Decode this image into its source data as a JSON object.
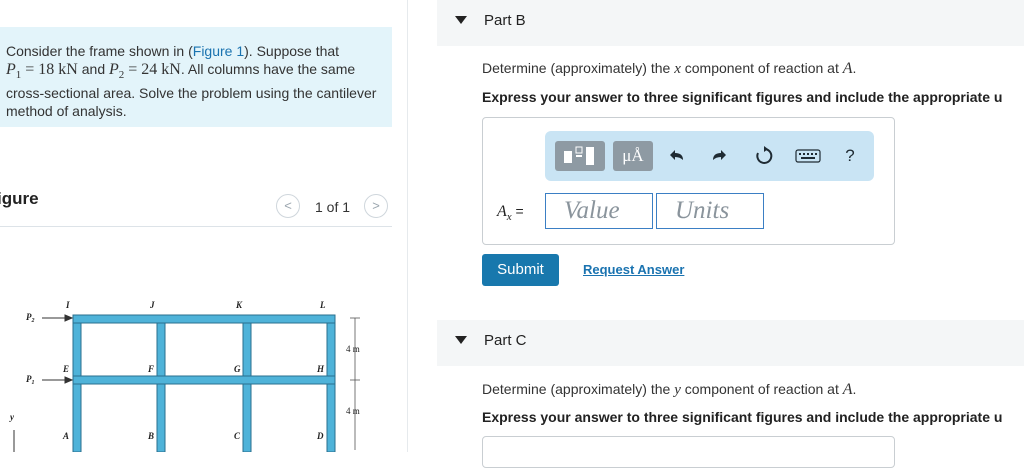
{
  "problem": {
    "intro": "Consider the frame shown in (",
    "figure_link": "Figure 1",
    "after_link": "). Suppose that",
    "p1": "P",
    "p1_sub": "1",
    "p1_val": " = 18 kN",
    "and": " and ",
    "p2": "P",
    "p2_sub": "2",
    "p2_val": " = 24 kN",
    "rest": ". All columns have the same cross-sectional area. Solve the problem using the cantilever method of analysis."
  },
  "figure": {
    "label": "igure",
    "page_indicator": "1 of 1",
    "prev": "<",
    "next": ">",
    "labels": {
      "P2": "P",
      "P2_sub": "2",
      "P1": "P",
      "P1_sub": "1",
      "I": "I",
      "J": "J",
      "K": "K",
      "L": "L",
      "E": "E",
      "F": "F",
      "G": "G",
      "H": "H",
      "A": "A",
      "B": "B",
      "C": "C",
      "D": "D",
      "dim1": "4 m",
      "dim2": "4 m",
      "y": "y"
    }
  },
  "part_b": {
    "title": "Part B",
    "question_prefix": "Determine (approximately) the ",
    "question_var": "x",
    "question_mid": " component of reaction at ",
    "question_point": "A",
    "question_end": ".",
    "instruction": "Express your answer to three significant figures and include the appropriate u",
    "answer_label": "A",
    "answer_sub": "x",
    "answer_eq": " =",
    "value_placeholder": "Value",
    "units_placeholder": "Units",
    "submit_label": "Submit",
    "request_label": "Request Answer",
    "toolbar": {
      "units_btn": "μÅ",
      "help": "?"
    }
  },
  "part_c": {
    "title": "Part C",
    "question_prefix": "Determine (approximately) the ",
    "question_var": "y",
    "question_mid": " component of reaction at ",
    "question_point": "A",
    "question_end": ".",
    "instruction": "Express your answer to three significant figures and include the appropriate u"
  },
  "colors": {
    "accent": "#1878ad",
    "link": "#1a73b0",
    "problem_bg": "#e3f4fa",
    "toolbar_bg": "#c9e4f4",
    "frame_fill": "#4fb3d9"
  }
}
